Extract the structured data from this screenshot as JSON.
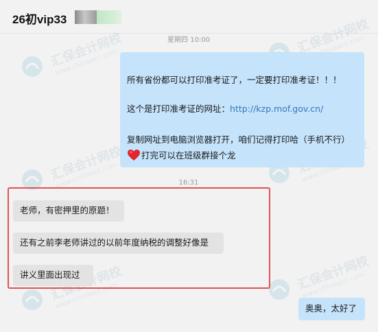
{
  "header": {
    "title": "26初vip33"
  },
  "colors": {
    "outgoing_bubble": "#c5e3fb",
    "incoming_bubble": "#e3e3e3",
    "link": "#3577b8",
    "highlight_border": "#e05252"
  },
  "watermark": {
    "name": "汇保会计网校",
    "url": "www.chinaacc.com"
  },
  "messages": {
    "time_1": "星期四 10:00",
    "outgoing_1": {
      "line_1": "所有省份都可以打印准考证了，一定要打印准考证！！！",
      "line_2_prefix": "这个是打印准考证的网址：",
      "line_2_link": "http://kzp.mof.gov.cn/",
      "line_3": "复制网址到电脑浏览器打开，咱们记得打印哈（手机不行）",
      "line_4_icon": "heart-icon",
      "line_4": "打完可以在班级群接个龙"
    },
    "time_2": "16:31",
    "incoming": [
      {
        "text": "老师，有密押里的原题！"
      },
      {
        "text": "还有之前李老师讲过的以前年度纳税的调整好像是"
      },
      {
        "text": "讲义里面出现过"
      }
    ],
    "outgoing_2": {
      "text": "奥奥，太好了"
    }
  }
}
